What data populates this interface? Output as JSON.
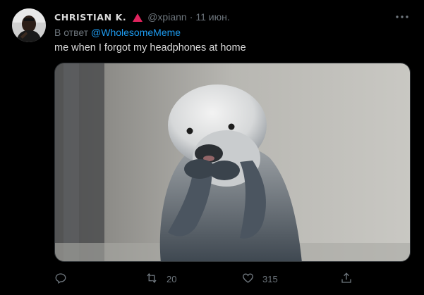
{
  "tweet": {
    "author_name": "CHRISTIAN K.",
    "author_handle": "@xpiann",
    "separator": "·",
    "date": "11 июн.",
    "reply_prefix": "В ответ",
    "reply_to": "@WholesomeMeme",
    "text": "me when I forgot my headphones at home",
    "media_alt": "otter covering its mouth with its paws"
  },
  "actions": {
    "retweet_count": "20",
    "like_count": "315"
  },
  "icons": {
    "flag": "red-triangle-icon",
    "more": "more-icon",
    "reply": "reply-icon",
    "retweet": "retweet-icon",
    "like": "heart-icon",
    "share": "share-icon"
  },
  "colors": {
    "background": "#000000",
    "text": "#d9d9d9",
    "muted": "#6e767d",
    "link": "#1d9bf0",
    "flag": "#e0245e"
  }
}
